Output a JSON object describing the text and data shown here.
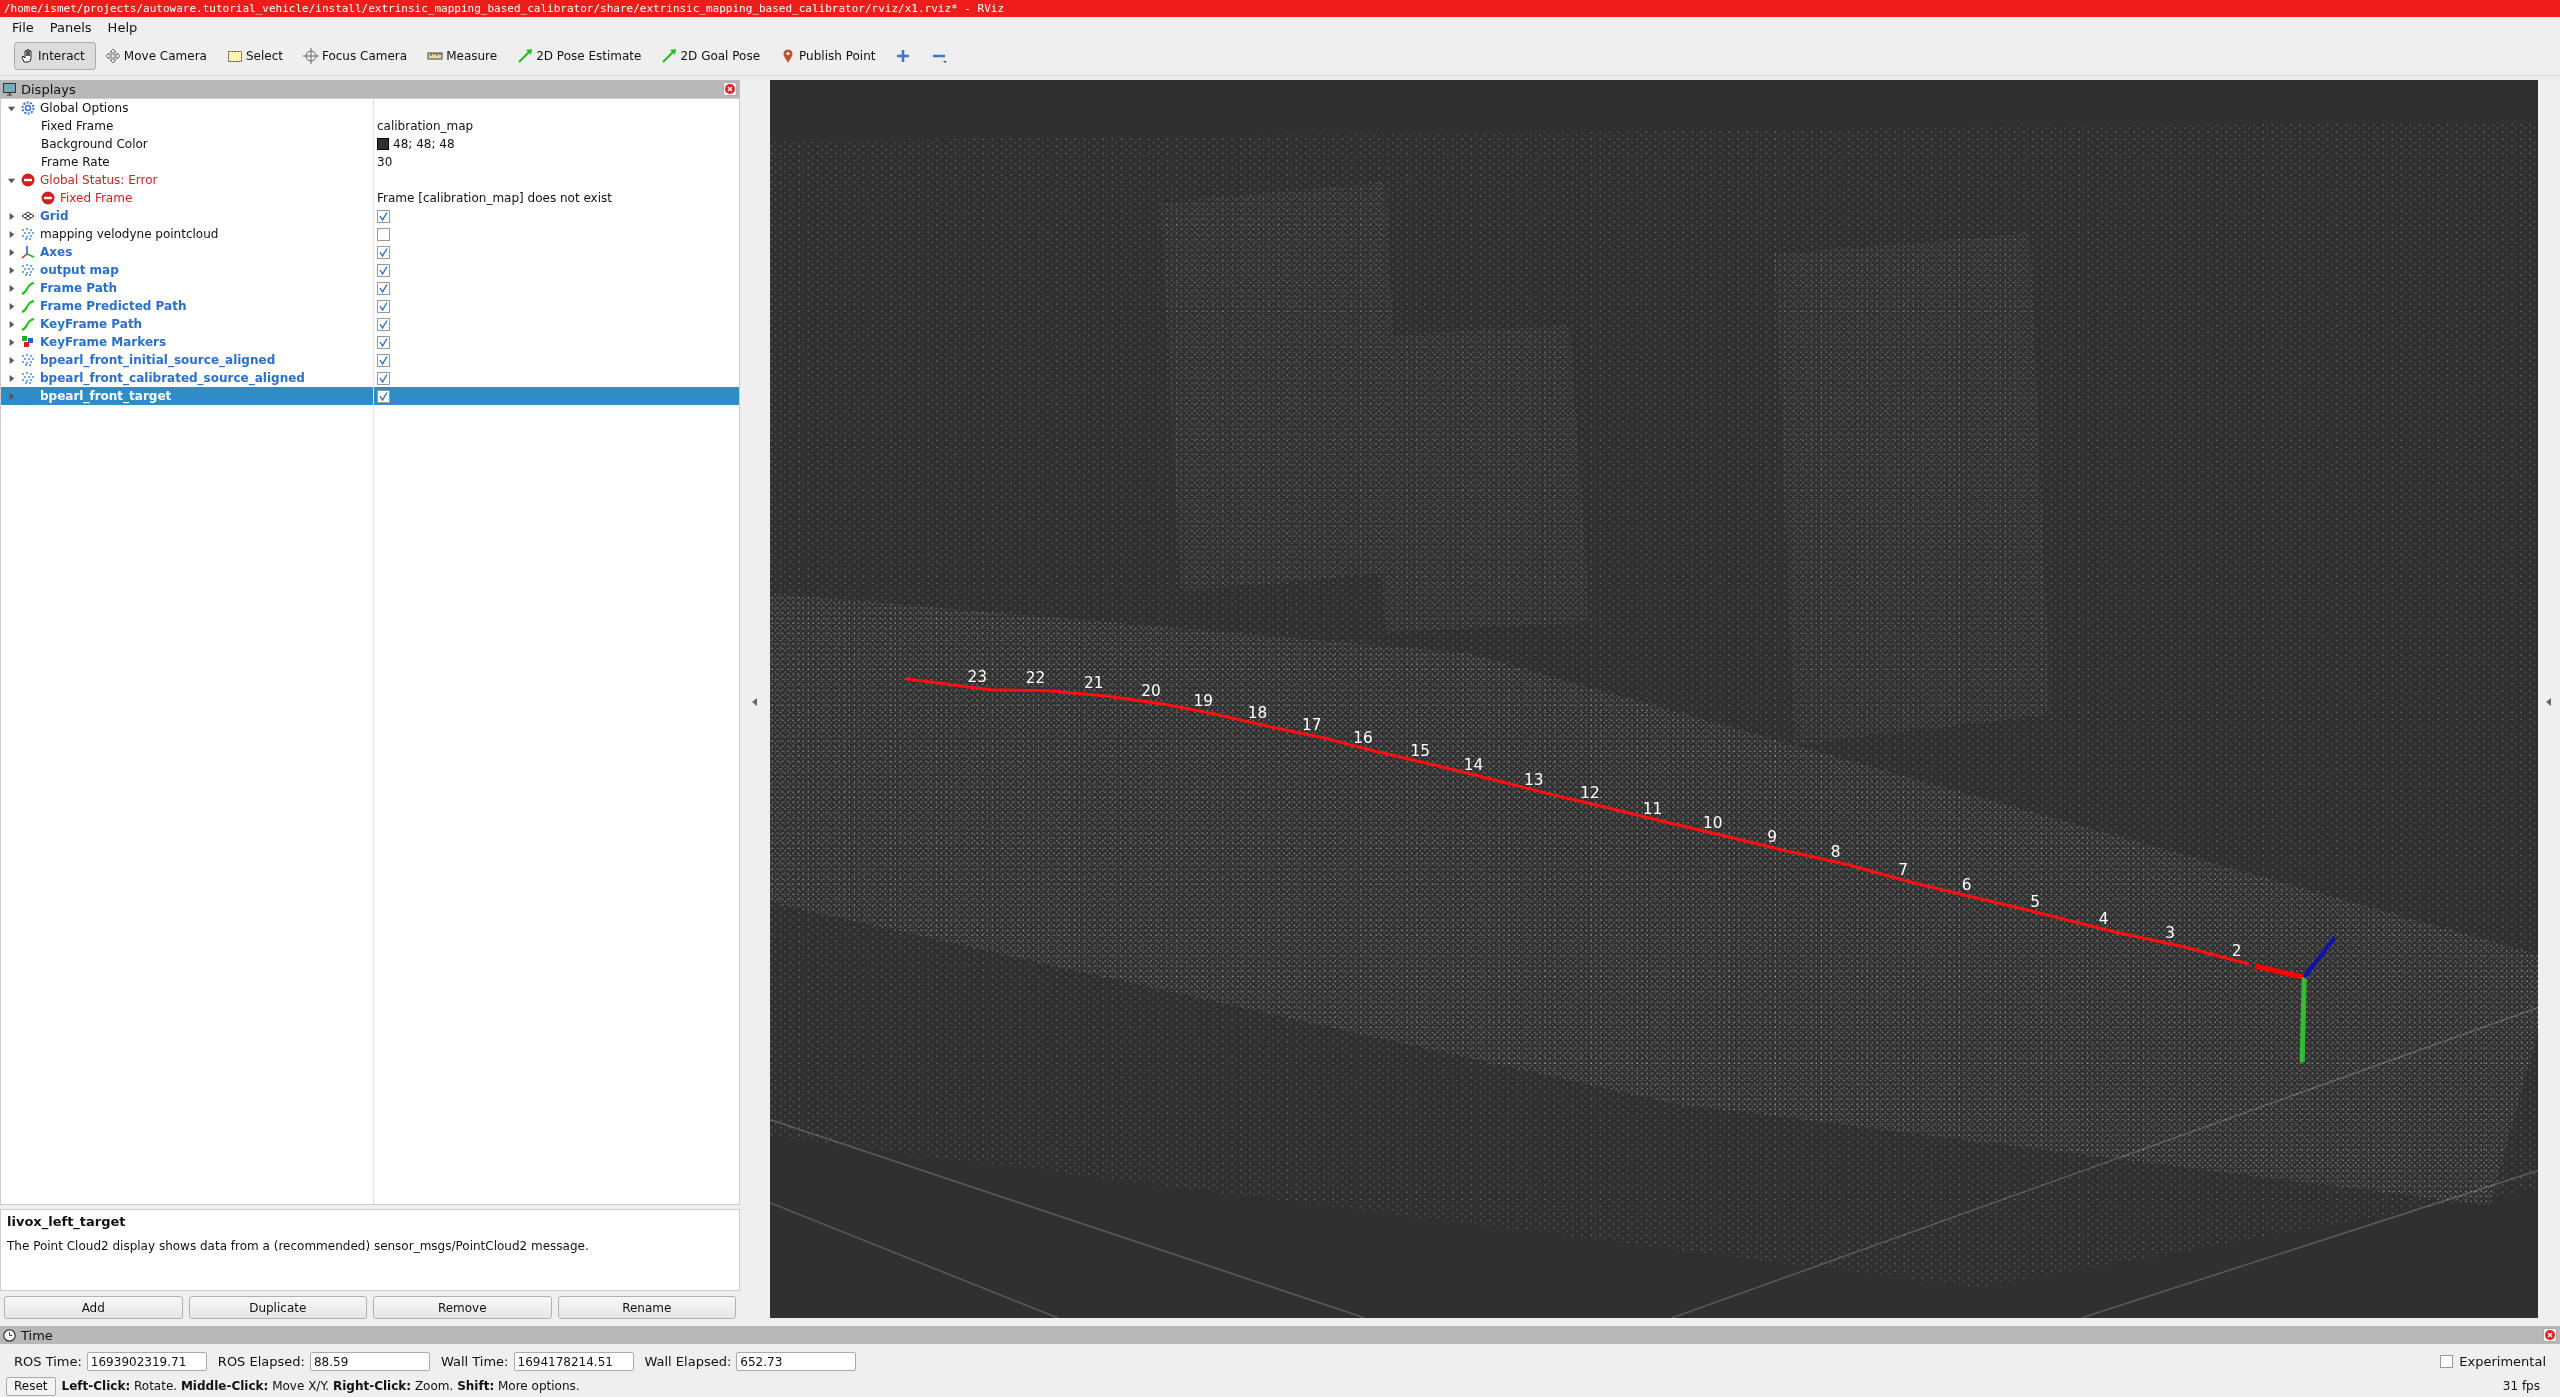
{
  "window": {
    "title": "/home/ismet/projects/autoware.tutorial_vehicle/install/extrinsic_mapping_based_calibrator/share/extrinsic_mapping_based_calibrator/rviz/x1.rviz* - RViz"
  },
  "menu": [
    "File",
    "Panels",
    "Help"
  ],
  "toolbar": [
    {
      "kind": "interact",
      "label": "Interact",
      "selected": true
    },
    {
      "kind": "move",
      "label": "Move Camera",
      "selected": false
    },
    {
      "kind": "select",
      "label": "Select",
      "selected": false
    },
    {
      "kind": "focus",
      "label": "Focus Camera",
      "selected": false
    },
    {
      "kind": "measure",
      "label": "Measure",
      "selected": false
    },
    {
      "kind": "pose",
      "label": "2D Pose Estimate",
      "selected": false
    },
    {
      "kind": "goal",
      "label": "2D Goal Pose",
      "selected": false
    },
    {
      "kind": "point",
      "label": "Publish Point",
      "selected": false
    },
    {
      "kind": "add"
    },
    {
      "kind": "remove"
    }
  ],
  "displays": {
    "title": "Displays",
    "tree": [
      {
        "kind": "options",
        "label": "Global Options",
        "expanded": true,
        "selected": false,
        "children": [
          {
            "kind": "property",
            "label": "Fixed Frame",
            "value": "calibration_map",
            "selected": false
          },
          {
            "kind": "property",
            "label": "Background Color",
            "value": "48; 48; 48",
            "color": "#303030",
            "selected": false
          },
          {
            "kind": "property",
            "label": "Frame Rate",
            "value": "30",
            "selected": false
          }
        ]
      },
      {
        "kind": "error",
        "label": "Global Status: Error",
        "expanded": true,
        "selected": false,
        "children": [
          {
            "kind": "error",
            "label": "Fixed Frame",
            "value": "Frame [calibration_map] does not exist",
            "selected": false
          }
        ]
      },
      {
        "kind": "grid",
        "label": "Grid",
        "expanded": false,
        "checked": true,
        "selected": false
      },
      {
        "kind": "cloud",
        "label": "mapping velodyne pointcloud",
        "expanded": false,
        "checked": false,
        "selected": false
      },
      {
        "kind": "axes",
        "label": "Axes",
        "expanded": false,
        "checked": true,
        "selected": false
      },
      {
        "kind": "cloud",
        "label": "output map",
        "expanded": false,
        "checked": true,
        "selected": false
      },
      {
        "kind": "path",
        "label": "Frame Path",
        "expanded": false,
        "checked": true,
        "selected": false
      },
      {
        "kind": "path",
        "label": "Frame Predicted Path",
        "expanded": false,
        "checked": true,
        "selected": false
      },
      {
        "kind": "path",
        "label": "KeyFrame Path",
        "expanded": false,
        "checked": true,
        "selected": false
      },
      {
        "kind": "markers",
        "label": "KeyFrame Markers",
        "expanded": false,
        "checked": true,
        "selected": false
      },
      {
        "kind": "cloud",
        "label": "bpearl_front_initial_source_aligned",
        "expanded": false,
        "checked": true,
        "selected": false
      },
      {
        "kind": "cloud",
        "label": "bpearl_front_calibrated_source_aligned",
        "expanded": false,
        "checked": true,
        "selected": false
      },
      {
        "kind": "cloud",
        "label": "bpearl_front_target",
        "expanded": false,
        "checked": true,
        "selected": true
      }
    ]
  },
  "description": {
    "title": "livox_left_target",
    "text": "The Point Cloud2 display shows data from a (recommended) sensor_msgs/PointCloud2 message."
  },
  "buttons": [
    "Add",
    "Duplicate",
    "Remove",
    "Rename"
  ],
  "viewport": {
    "keyframe_labels": [
      "23",
      "22",
      "21",
      "20",
      "19",
      "18",
      "17",
      "16",
      "15",
      "14",
      "13",
      "12",
      "11",
      "10",
      "9",
      "8",
      "7",
      "6",
      "5",
      "4",
      "3",
      "2"
    ]
  },
  "time": {
    "title": "Time",
    "fields": [
      {
        "label": "ROS Time:",
        "value": "1693902319.71"
      },
      {
        "label": "ROS Elapsed:",
        "value": "88.59"
      },
      {
        "label": "Wall Time:",
        "value": "1694178214.51"
      },
      {
        "label": "Wall Elapsed:",
        "value": "652.73"
      }
    ],
    "experimental": {
      "label": "Experimental",
      "checked": false
    }
  },
  "status_bar": {
    "reset": "Reset",
    "hint": "**Left-Click:** Rotate. **Middle-Click:** Move X/Y. **Right-Click:** Zoom. **Shift:** More options.",
    "fps": "31 fps"
  }
}
